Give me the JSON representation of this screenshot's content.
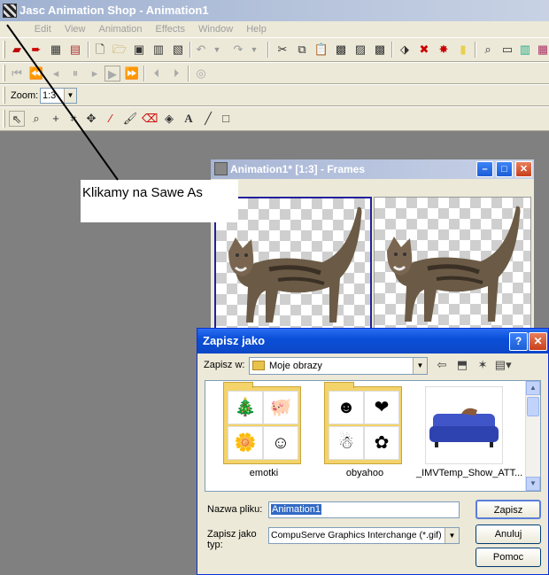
{
  "app": {
    "title": "Jasc Animation Shop - Animation1",
    "menu": [
      "File",
      "Edit",
      "View",
      "Animation",
      "Effects",
      "Window",
      "Help"
    ],
    "zoom_label": "Zoom:",
    "zoom_value": "1:3"
  },
  "annotation": {
    "text": "Klikamy na Sawe As"
  },
  "frames_window": {
    "title": "Animation1* [1:3] - Frames"
  },
  "save_dialog": {
    "title": "Zapisz jako",
    "save_in_label": "Zapisz w:",
    "save_in_value": "Moje obrazy",
    "files": [
      {
        "name": "emotki"
      },
      {
        "name": "obyahoo"
      },
      {
        "name": "_IMVTemp_Show_ATT..."
      }
    ],
    "filename_label": "Nazwa pliku:",
    "filename_value": "Animation1",
    "filetype_label": "Zapisz jako typ:",
    "filetype_value": "CompuServe Graphics Interchange (*.gif)",
    "buttons": {
      "save": "Zapisz",
      "cancel": "Anuluj",
      "help": "Pomoc"
    }
  }
}
